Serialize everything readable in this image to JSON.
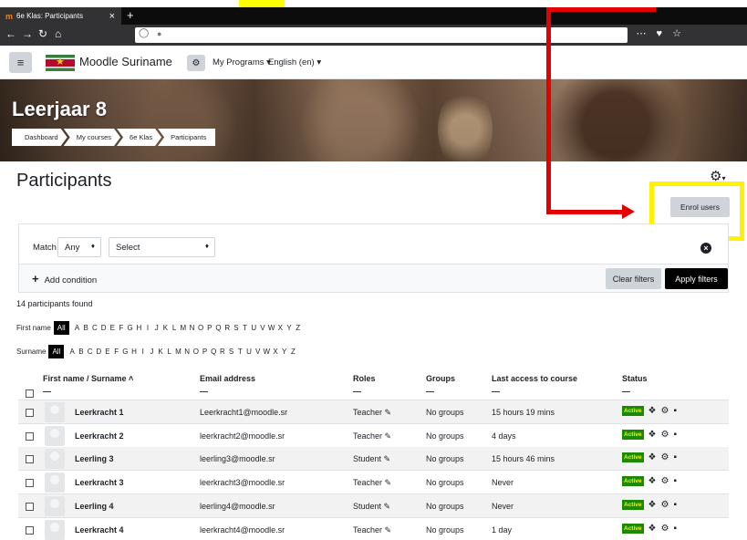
{
  "browser": {
    "tab_title": "6e Klas: Participants",
    "close_icon": "×",
    "new_tab": "+",
    "nav_icons": "⋯ ♥ ☆"
  },
  "header": {
    "site_name": "Moodle Suriname",
    "menu_programs": "My Programs ▾",
    "menu_language": "English (en) ▾"
  },
  "course": {
    "title": "Leerjaar 8",
    "breadcrumb": [
      "Dashboard",
      "My courses",
      "6e Klas",
      "Participants"
    ]
  },
  "page": {
    "title": "Participants",
    "enrol_label": "Enrol users"
  },
  "filter": {
    "match_label": "Match",
    "match_value": "Any",
    "select_value": "Select",
    "add_condition": "Add condition",
    "clear_filters": "Clear filters",
    "apply_filters": "Apply filters"
  },
  "summary": {
    "found": "14 participants found",
    "first_name_label": "First name",
    "surname_label": "Surname",
    "all_label": "All",
    "letters": [
      "A",
      "B",
      "C",
      "D",
      "E",
      "F",
      "G",
      "H",
      "I",
      "J",
      "K",
      "L",
      "M",
      "N",
      "O",
      "P",
      "Q",
      "R",
      "S",
      "T",
      "U",
      "V",
      "W",
      "X",
      "Y",
      "Z"
    ]
  },
  "table": {
    "headers": {
      "name": "First name / Surname ˄",
      "email": "Email address",
      "roles": "Roles",
      "groups": "Groups",
      "last_access": "Last access to course",
      "status": "Status"
    },
    "rows": [
      {
        "name": "Leerkracht 1",
        "email": "Leerkracht1@moodle.sr",
        "role": "Teacher ✎",
        "groups": "No groups",
        "last_access": "15 hours 19 mins",
        "status": "Active"
      },
      {
        "name": "Leerkracht 2",
        "email": "leerkracht2@moodle.sr",
        "role": "Teacher ✎",
        "groups": "No groups",
        "last_access": "4 days",
        "status": "Active"
      },
      {
        "name": "Leerling 3",
        "email": "leerling3@moodle.sr",
        "role": "Student ✎",
        "groups": "No groups",
        "last_access": "15 hours 46 mins",
        "status": "Active"
      },
      {
        "name": "Leerkracht 3",
        "email": "leerkracht3@moodle.sr",
        "role": "Teacher ✎",
        "groups": "No groups",
        "last_access": "Never",
        "status": "Active"
      },
      {
        "name": "Leerling 4",
        "email": "leerling4@moodle.sr",
        "role": "Student ✎",
        "groups": "No groups",
        "last_access": "Never",
        "status": "Active"
      },
      {
        "name": "Leerkracht 4",
        "email": "leerkracht4@moodle.sr",
        "role": "Teacher ✎",
        "groups": "No groups",
        "last_access": "1 day",
        "status": "Active"
      }
    ]
  },
  "colors": {
    "highlight_box": "#fff200",
    "arrow": "#e30000",
    "status_badge": "#1a8a00"
  }
}
